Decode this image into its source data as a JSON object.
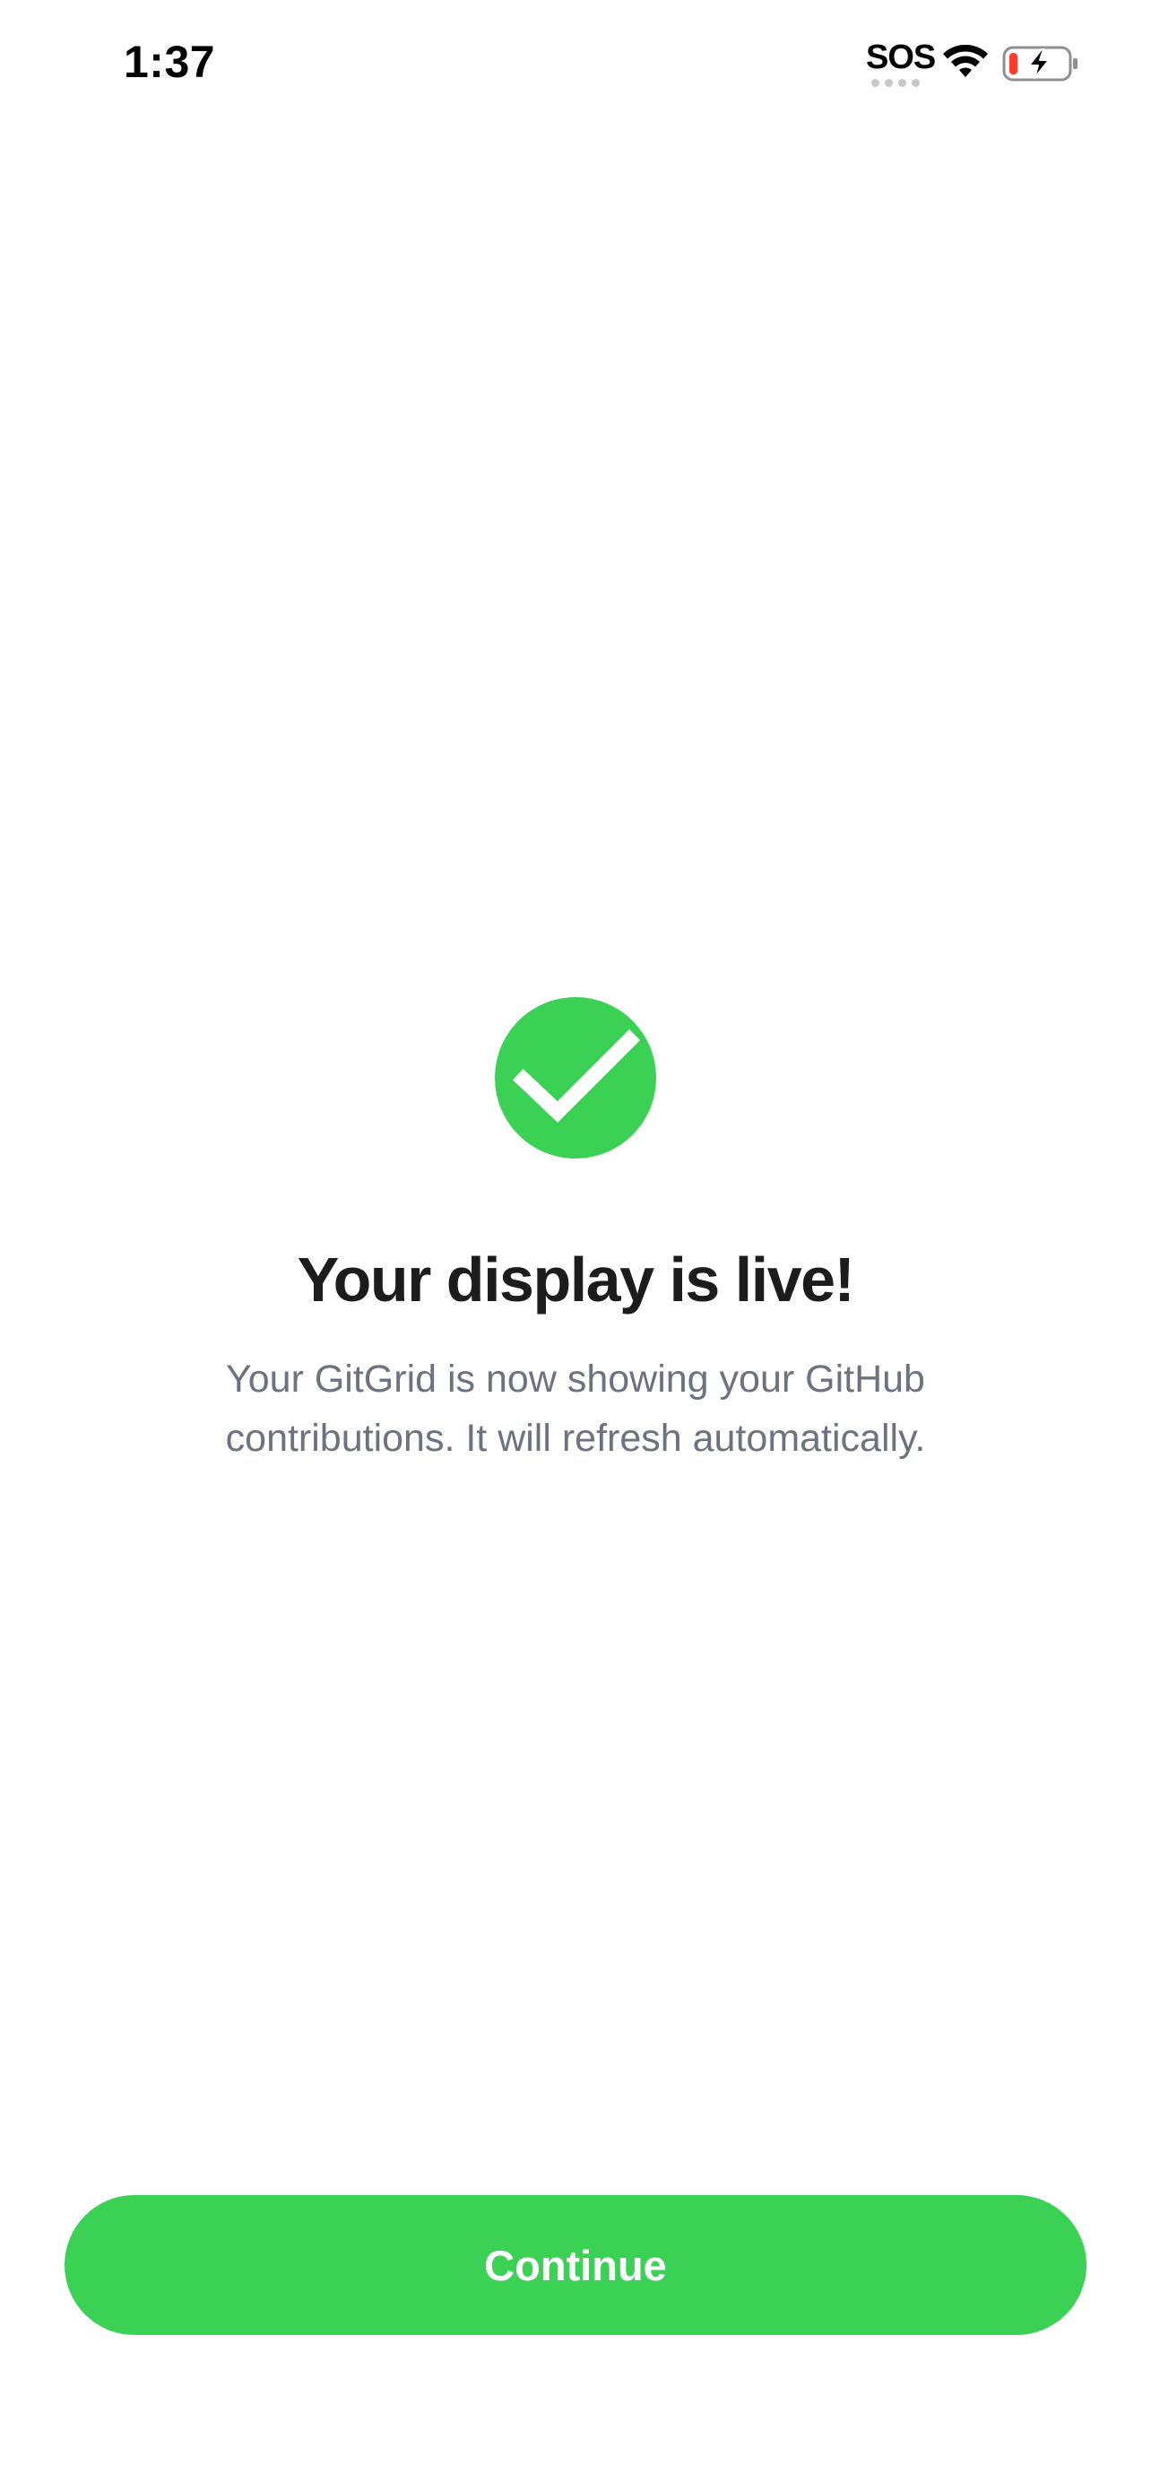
{
  "status_bar": {
    "time": "1:37",
    "sos_label": "SOS",
    "wifi_icon": "wifi-icon",
    "battery_icon": "battery-charging-icon",
    "battery_low_color": "#ff3b30"
  },
  "main": {
    "success_icon": "checkmark-circle-icon",
    "title": "Your display is live!",
    "subtitle_line1": "Your GitGrid is now showing your GitHub",
    "subtitle_line2": "contributions. It will refresh automatically."
  },
  "footer": {
    "continue_label": "Continue"
  },
  "colors": {
    "accent_green": "#3ad155",
    "title_text": "#1c1c1e",
    "subtitle_text": "#6b7280",
    "background": "#ffffff"
  }
}
